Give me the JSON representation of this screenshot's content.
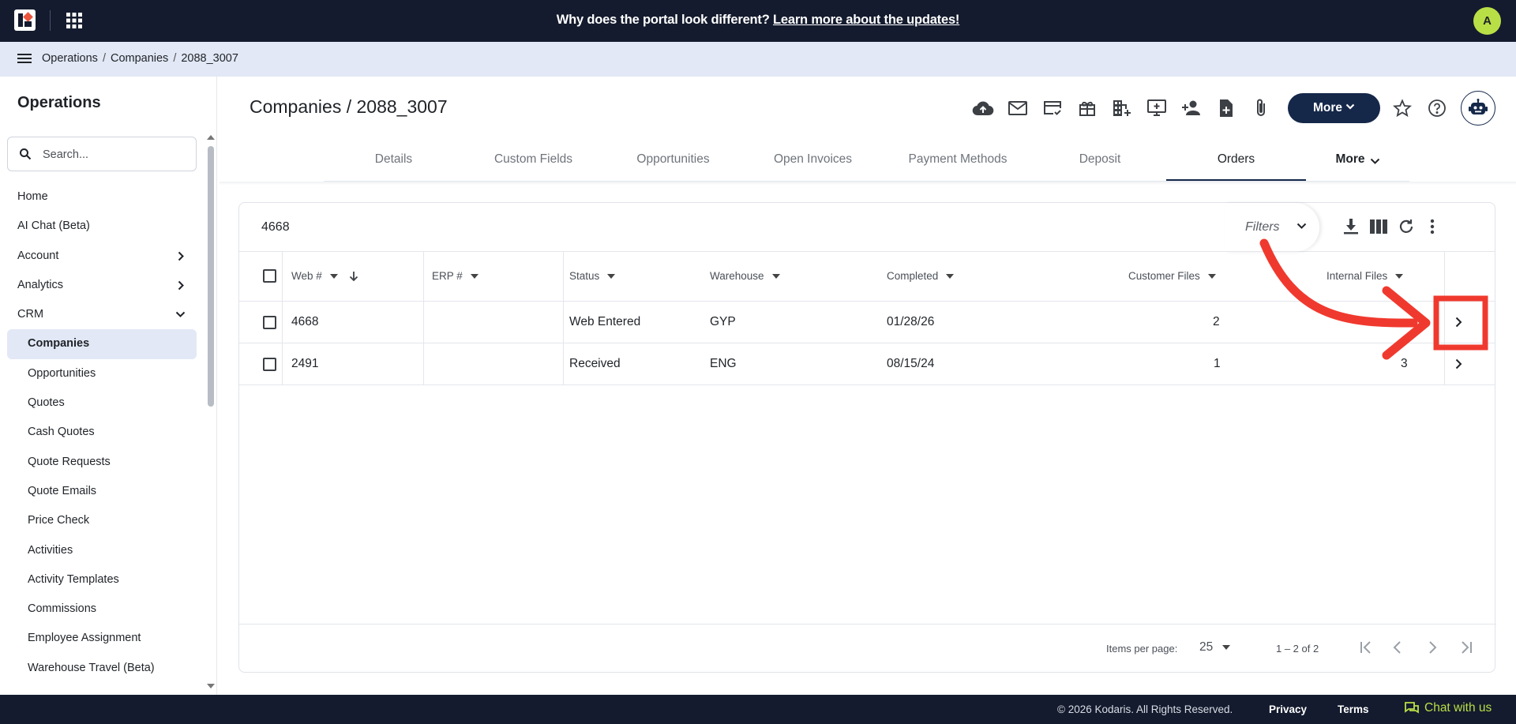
{
  "topbar": {
    "announcement_text": "Why does the portal look different?",
    "announcement_link": "Learn more about the updates!",
    "avatar_initial": "A"
  },
  "breadcrumb": {
    "items": [
      "Operations",
      "Companies",
      "2088_3007"
    ]
  },
  "sidebar": {
    "title": "Operations",
    "search_placeholder": "Search...",
    "items": [
      {
        "label": "Home"
      },
      {
        "label": "AI Chat (Beta)"
      },
      {
        "label": "Account"
      },
      {
        "label": "Analytics"
      },
      {
        "label": "CRM"
      },
      {
        "label": "Companies"
      },
      {
        "label": "Opportunities"
      },
      {
        "label": "Quotes"
      },
      {
        "label": "Cash Quotes"
      },
      {
        "label": "Quote Requests"
      },
      {
        "label": "Quote Emails"
      },
      {
        "label": "Price Check"
      },
      {
        "label": "Activities"
      },
      {
        "label": "Activity Templates"
      },
      {
        "label": "Commissions"
      },
      {
        "label": "Employee Assignment"
      },
      {
        "label": "Warehouse Travel (Beta)"
      }
    ]
  },
  "page": {
    "title": "Companies / 2088_3007",
    "more_button": "More",
    "toolbar_icons": [
      "cloud-upload-icon",
      "mail-icon",
      "credit-card-check-icon",
      "gift-icon",
      "building-add-icon",
      "add-to-screen-icon",
      "person-add-icon",
      "file-add-icon",
      "paperclip-icon"
    ]
  },
  "tabs": [
    {
      "label": "Details"
    },
    {
      "label": "Custom Fields"
    },
    {
      "label": "Opportunities"
    },
    {
      "label": "Open Invoices"
    },
    {
      "label": "Payment Methods"
    },
    {
      "label": "Deposit"
    },
    {
      "label": "Orders"
    },
    {
      "label": "More"
    }
  ],
  "active_tab": "Orders",
  "table": {
    "search_value": "4668",
    "filters_label": "Filters",
    "columns": [
      "Web #",
      "ERP #",
      "Status",
      "Warehouse",
      "Completed",
      "Customer Files",
      "Internal Files"
    ],
    "rows": [
      {
        "web": "4668",
        "erp": "",
        "status": "Web Entered",
        "warehouse": "GYP",
        "completed": "01/28/26",
        "customer_files": "2",
        "internal_files": ""
      },
      {
        "web": "2491",
        "erp": "",
        "status": "Received",
        "warehouse": "ENG",
        "completed": "08/15/24",
        "customer_files": "1",
        "internal_files": "3"
      }
    ],
    "items_per_page_label": "Items per page:",
    "items_per_page": "25",
    "range": "1 – 2 of 2"
  },
  "footer": {
    "copyright": "© 2026 Kodaris. All Rights Reserved.",
    "privacy": "Privacy",
    "terms": "Terms",
    "chat": "Chat with us"
  },
  "colors": {
    "navy": "#141b2e",
    "accent_green": "#b9df46",
    "annotation_red": "#f0392e"
  }
}
